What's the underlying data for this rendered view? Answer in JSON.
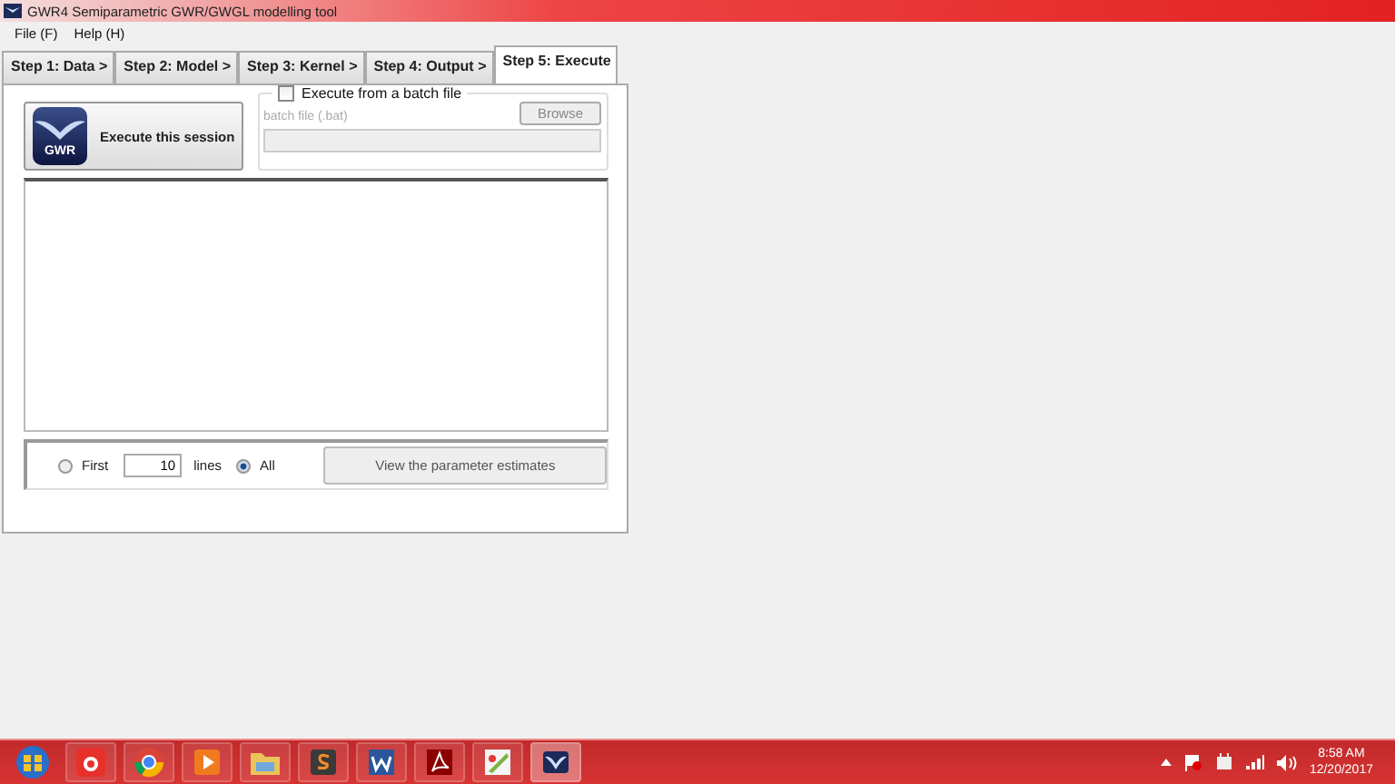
{
  "window": {
    "title": "GWR4  Semiparametric GWR/GWGL modelling tool"
  },
  "menu": [
    "File (F)",
    "Help (H)"
  ],
  "tabs": [
    {
      "label": "Step 1: Data >",
      "selected": false
    },
    {
      "label": "Step 2: Model >",
      "selected": false
    },
    {
      "label": "Step 3: Kernel >",
      "selected": false
    },
    {
      "label": "Step 4: Output >",
      "selected": false
    },
    {
      "label": "Step 5: Execute",
      "selected": true
    }
  ],
  "execute_button": {
    "label": "Execute this session",
    "icon_text": "GWR"
  },
  "batch": {
    "label": "Execute from a batch file",
    "checked": false,
    "field_label": "batch file (.bat)",
    "browse": "Browse",
    "disabled": true
  },
  "output_options": [
    {
      "kind": "radio",
      "label": "First",
      "selected": false
    },
    {
      "kind": "field",
      "value": "10"
    },
    {
      "kind": "text",
      "label": "lines"
    },
    {
      "kind": "radio",
      "label": "All",
      "selected": true
    }
  ],
  "view_button": "View the parameter estimates",
  "tray": {
    "time": "8:58 AM",
    "date": "12/20/2017"
  }
}
